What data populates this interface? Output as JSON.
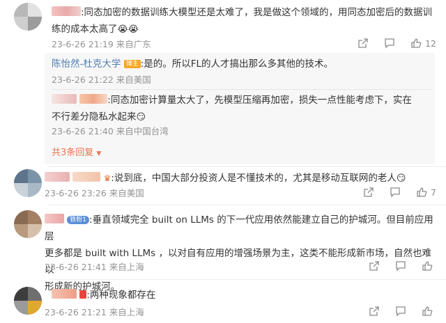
{
  "comments": [
    {
      "text": ":同态加密的数据训练大模型还是太难了，我是做这个领域的，用同态加密后的数据训练的成本太高了",
      "emoji": "😭😭",
      "time": "23-6-26 21:19",
      "location": "来自广东",
      "likes": "12"
    },
    {
      "text": ":说到底，中国大部分投资人是不懂技术的，尤其是移动互联网的老人",
      "emoji": "😏",
      "time": "23-6-26 23:26",
      "location": "来自美国",
      "likes": "7"
    },
    {
      "badge": "铁粉1",
      "text_line1": ":垂直领域完全 built on LLMs 的下一代应用依然能建立自己的护城河。但目前应用层",
      "text_line2": "更多都是 built with LLMs ，以对自有应用的增强场景为主，这类不能形成新市场，自然也难以",
      "text_line3": "形成新的护城河。",
      "time": "23-6-26 21:41",
      "location": "来自上海",
      "likes": ""
    },
    {
      "text": ":两种现象都存在",
      "time": "23-6-26 21:21",
      "location": "来自上海",
      "likes": ""
    }
  ],
  "replies": [
    {
      "username": "陈怡然-杜克大学",
      "tag": "博主",
      "text": ":是的。所以FL的人才搞出那么多其他的技术。",
      "time": "23-6-26 21:22",
      "location": "来自美国"
    },
    {
      "text_line1": ":同态加密计算量太大了，先模型压缩再加密，损失一点性能考虑下，实在",
      "text_line2": "不行差分隐私水起来",
      "emoji": "😏",
      "time": "23-6-26 21:40",
      "location": "来自中国台湾"
    }
  ],
  "more_replies": "共3条回复",
  "colors": {
    "accent": "#eb7350",
    "username": "#507daf",
    "meta": "#939393"
  }
}
